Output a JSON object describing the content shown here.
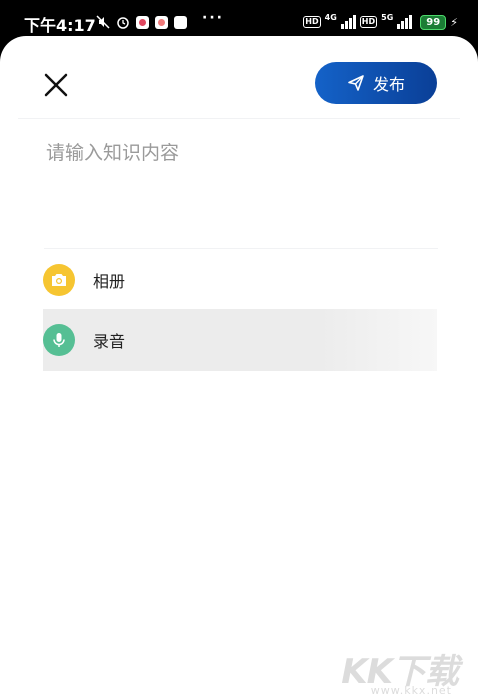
{
  "status_bar": {
    "time": "下午4:17",
    "more": "···",
    "hd1": "HD",
    "net1": "4G",
    "hd2": "HD",
    "net2": "5G",
    "battery": "99"
  },
  "header": {
    "publish_label": "发布"
  },
  "editor": {
    "placeholder": "请输入知识内容",
    "value": ""
  },
  "options": [
    {
      "label": "相册",
      "icon": "camera-icon",
      "color": "#f6c531"
    },
    {
      "label": "录音",
      "icon": "microphone-icon",
      "color": "#56bf94"
    }
  ],
  "watermark": {
    "brand": "KK下载",
    "url": "www.kkx.net"
  }
}
